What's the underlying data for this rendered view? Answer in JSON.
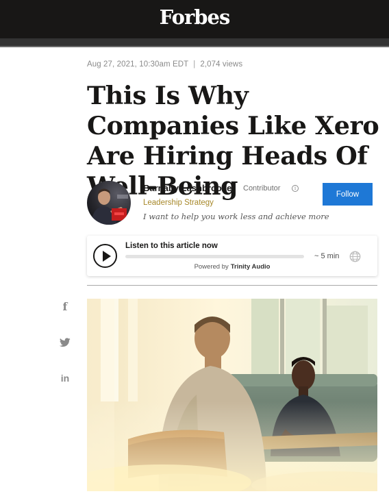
{
  "header": {
    "logo": "Forbes"
  },
  "article": {
    "meta_date": "Aug 27, 2021, 10:30am EDT",
    "meta_separator": "|",
    "meta_views": "2,074 views",
    "headline": "This Is Why Companies Like Xero Are Hiring Heads Of Well-Being"
  },
  "author": {
    "name": "Barnaby Lashbrooke",
    "role": "Contributor",
    "info_icon_glyph": "i",
    "topic": "Leadership Strategy",
    "bio": "I want to help you work less and achieve more",
    "follow_label": "Follow"
  },
  "audio_player": {
    "title": "Listen to this article now",
    "duration": "~ 5 min",
    "powered_prefix": "Powered by",
    "powered_brand": "Trinity Audio",
    "progress": 0
  },
  "share": {
    "facebook_glyph": "f",
    "linkedin_glyph": "in"
  },
  "icons": [
    "facebook-icon",
    "twitter-icon",
    "linkedin-icon",
    "play-icon",
    "globe-icon",
    "info-icon"
  ],
  "colors": {
    "header_bg": "#181716",
    "follow_button": "#1e78d6",
    "topic_link": "#a7882a",
    "share_icon": "#8a8a8a"
  }
}
